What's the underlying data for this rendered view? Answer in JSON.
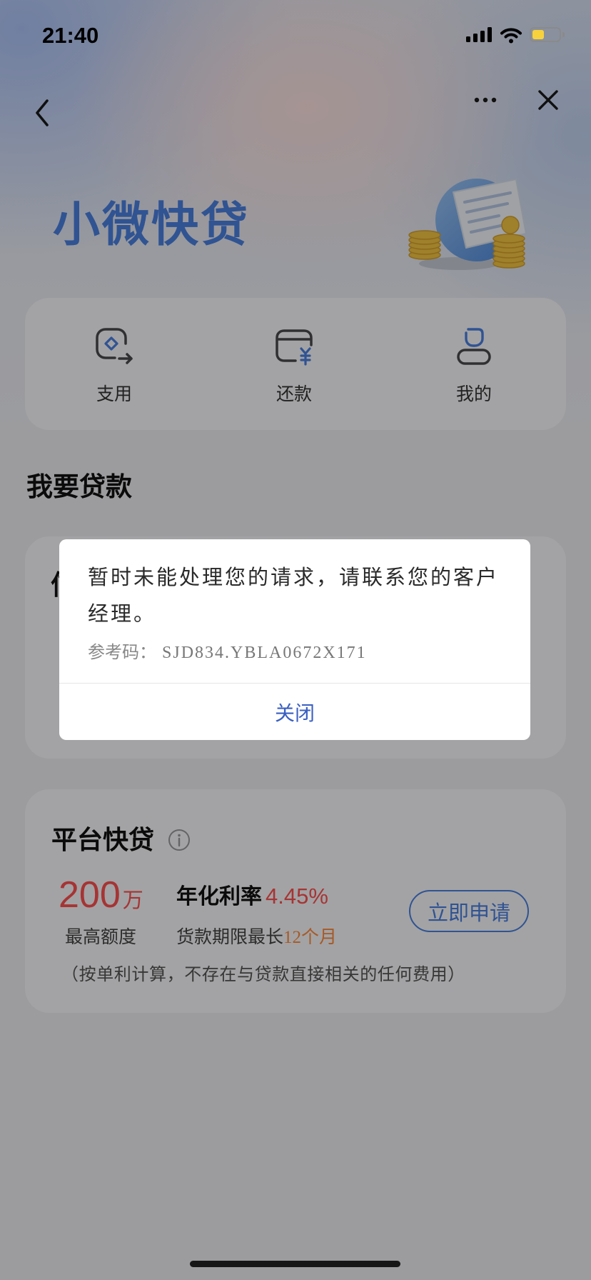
{
  "status_bar": {
    "time": "21:40",
    "battery_level": 0.45,
    "icons": {
      "signal": "cellular-signal-icon",
      "wifi": "wifi-icon",
      "battery": "battery-icon"
    }
  },
  "nav": {
    "back_icon": "chevron-left-icon",
    "more_icon": "more-horizontal-icon",
    "close_icon": "close-icon"
  },
  "header": {
    "title": "小微快贷",
    "illustration": "receipt-coins-illustration"
  },
  "quick_actions": [
    {
      "label": "支用",
      "icon": "withdraw-icon"
    },
    {
      "label": "还款",
      "icon": "repay-wallet-icon"
    },
    {
      "label": "我的",
      "icon": "user-profile-icon"
    }
  ],
  "loan_section": {
    "title": "我要贷款"
  },
  "credit_loan_card": {
    "title_fragment": "信"
  },
  "platform_loan_card": {
    "title": "平台快贷",
    "info_icon": "info-icon",
    "amount": "200",
    "amount_unit": "万",
    "amount_caption": "最高额度",
    "rate_label": "年化利率",
    "rate_value": "4.45%",
    "term_label": "货款期限最长",
    "term_value": "12个月",
    "apply_button": "立即申请",
    "note": "（按单利计算，不存在与贷款直接相关的任何费用）"
  },
  "dialog": {
    "message": "暂时未能处理您的请求，请联系您的客户经理。",
    "ref_label": "参考码：",
    "ref_code": "SJD834.YBLA0672X171",
    "close_button": "关闭"
  },
  "colors": {
    "brand_blue": "#4a80e0",
    "amount_red": "#ff5050",
    "term_orange": "#ff8a3d",
    "dialog_link_blue": "#3a5fc2",
    "coin_gold": "#f5c542",
    "battery_yellow": "#f7d23c",
    "overlay": "rgba(0,0,0,0.35)"
  }
}
